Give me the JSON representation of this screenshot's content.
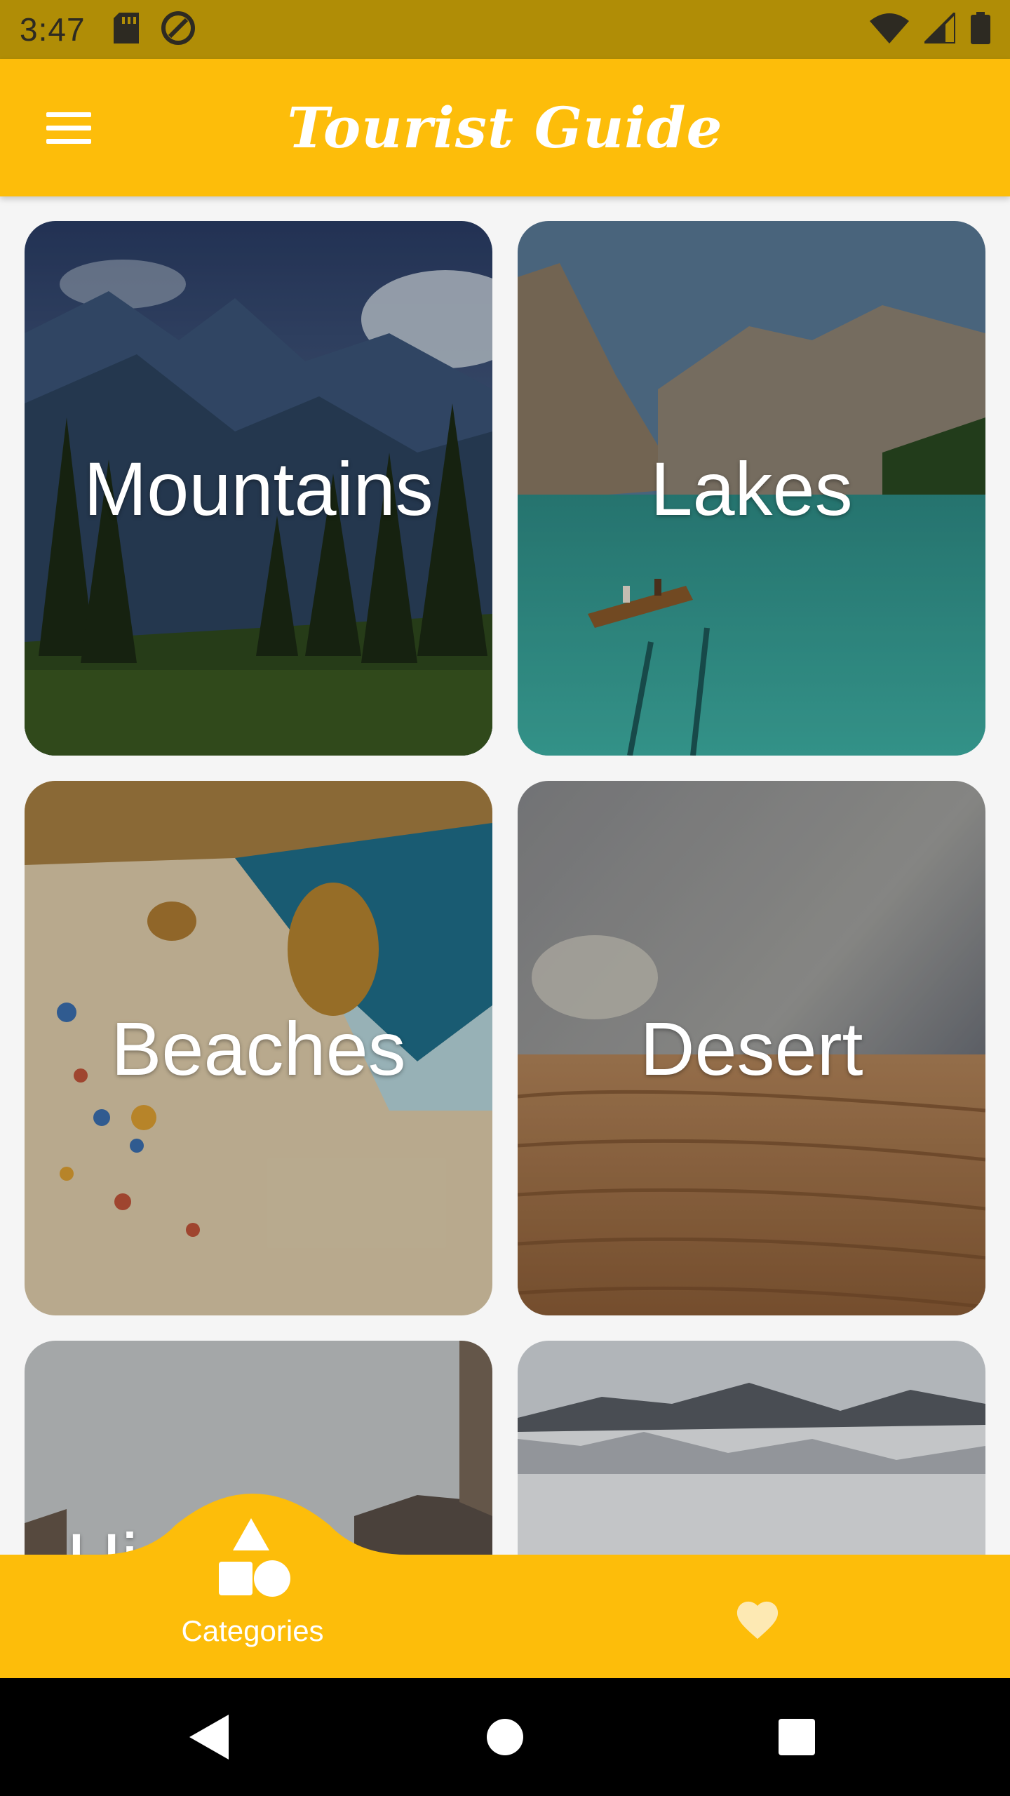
{
  "status_bar": {
    "time": "3:47",
    "icons": [
      "sd-card-icon",
      "data-saver-icon",
      "wifi-icon",
      "signal-icon",
      "battery-icon"
    ]
  },
  "app_bar": {
    "title": "Tourist Guide",
    "menu_icon": "hamburger-menu-icon"
  },
  "categories": [
    {
      "label": "Mountains"
    },
    {
      "label": "Lakes"
    },
    {
      "label": "Beaches"
    },
    {
      "label": "Desert"
    },
    {
      "label": "Hi"
    },
    {
      "label": ""
    }
  ],
  "bottom_nav": {
    "items": [
      {
        "label": "Categories",
        "icon": "shapes-icon",
        "selected": true
      },
      {
        "label": "",
        "icon": "heart-icon",
        "selected": false
      }
    ]
  },
  "system_nav": {
    "buttons": [
      "back-icon",
      "home-icon",
      "recents-icon"
    ]
  },
  "colors": {
    "status_bar": "#b08d06",
    "primary": "#fdbd0a",
    "background": "#f5f5f5",
    "heart": "#fde9b3"
  }
}
